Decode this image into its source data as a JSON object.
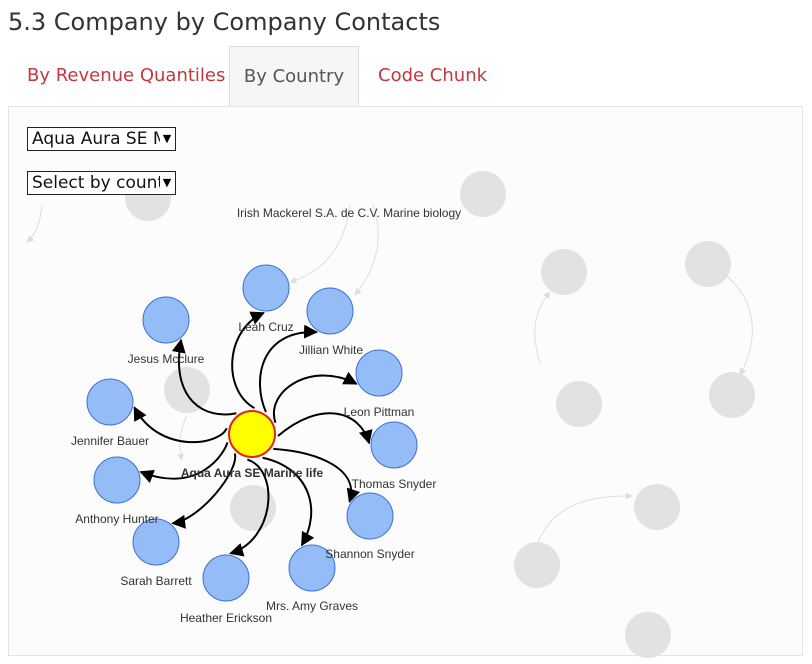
{
  "page": {
    "title": "5.3 Company by Company Contacts"
  },
  "tabs": [
    {
      "label": "By Revenue Quantiles",
      "active": false
    },
    {
      "label": "By Country",
      "active": true
    },
    {
      "label": "Code Chunk",
      "active": false
    }
  ],
  "controls": {
    "company_select": {
      "value": "Aqua Aura SE M"
    },
    "country_select": {
      "value": "Select by count"
    }
  },
  "network": {
    "center": {
      "label": "Aqua Aura SE Marine life",
      "color": "#ffff00",
      "stroke": "#e0261b"
    },
    "contact_color": "#94bcf7",
    "contact_stroke": "#3f6fd1",
    "faded_color": "#e2e2e2",
    "contacts": [
      "Leah Cruz",
      "Jillian White",
      "Leon Pittman",
      "Thomas Snyder",
      "Shannon Snyder",
      "Mrs. Amy Graves",
      "Heather Erickson",
      "Sarah Barrett",
      "Anthony Hunter",
      "Jennifer Bauer",
      "Jesus Mcclure"
    ],
    "faded_label": "Irish Mackerel S.A. de C.V. Marine biology"
  }
}
